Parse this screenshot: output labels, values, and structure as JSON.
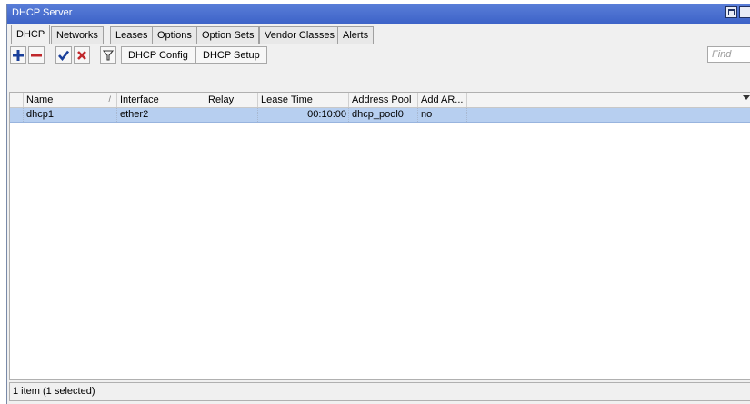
{
  "window": {
    "title": "DHCP Server"
  },
  "tabs": [
    {
      "label": "DHCP"
    },
    {
      "label": "Networks"
    },
    {
      "label": "Leases"
    },
    {
      "label": "Options"
    },
    {
      "label": "Option Sets"
    },
    {
      "label": "Vendor Classes"
    },
    {
      "label": "Alerts"
    }
  ],
  "active_tab": "DHCP",
  "toolbar": {
    "add_icon": "plus-icon",
    "remove_icon": "minus-icon",
    "enable_icon": "check-icon",
    "disable_icon": "x-icon",
    "filter_icon": "filter-icon",
    "dhcp_config_label": "DHCP Config",
    "dhcp_setup_label": "DHCP Setup",
    "find_placeholder": "Find"
  },
  "table": {
    "columns": [
      "Name",
      "Interface",
      "Relay",
      "Lease Time",
      "Address Pool",
      "Add AR..."
    ],
    "rows": [
      {
        "name": "dhcp1",
        "interface": "ether2",
        "relay": "",
        "lease_time": "00:10:00",
        "address_pool": "dhcp_pool0",
        "add_arp": "no",
        "selected": true
      }
    ]
  },
  "status": {
    "text": "1 item (1 selected)"
  },
  "colors": {
    "titlebar": "#3d63c8",
    "selected_row": "#b7cff0",
    "add_icon": "#1a3f9a",
    "remove_icon": "#c0282c",
    "enable_icon": "#1a3f9a",
    "disable_icon": "#c0282c"
  }
}
